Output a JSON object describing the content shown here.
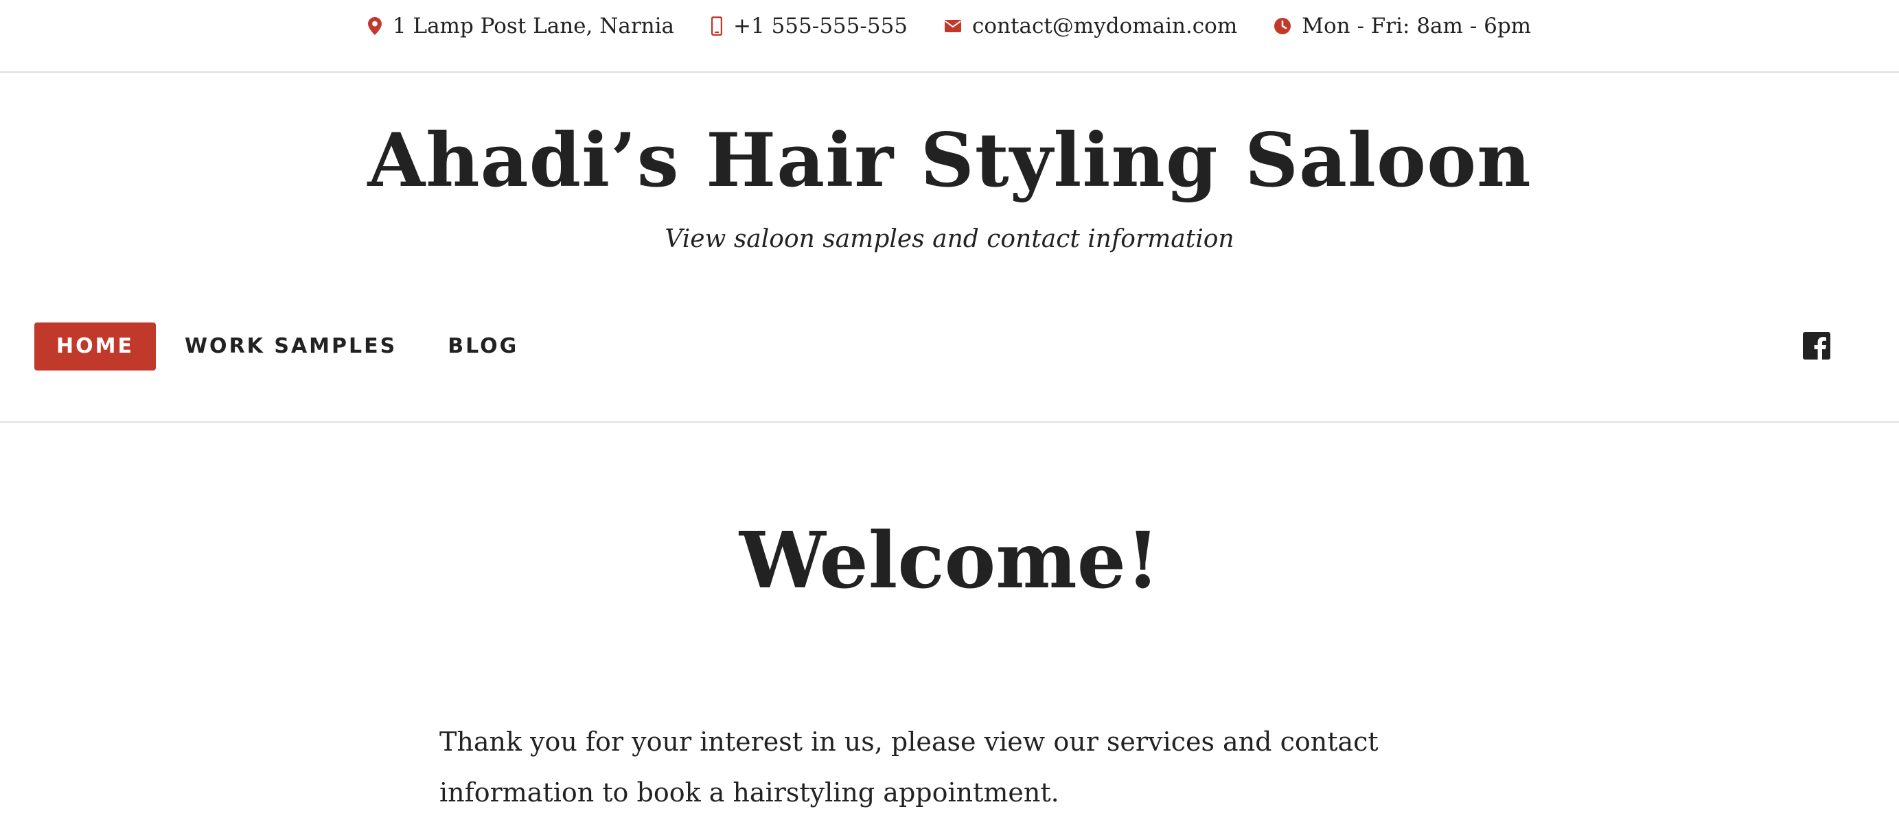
{
  "topbar": {
    "address": "1 Lamp Post Lane, Narnia",
    "phone": "+1 555-555-555",
    "email": "contact@mydomain.com",
    "hours": "Mon - Fri: 8am - 6pm",
    "icons": [
      "map-pin-icon",
      "mobile-phone-icon",
      "envelope-icon",
      "clock-icon"
    ],
    "icon_color": "#c0392b"
  },
  "site": {
    "title": "Ahadi’s Hair Styling Saloon",
    "tagline": "View saloon samples and contact information"
  },
  "nav": {
    "items": [
      {
        "label": "HOME",
        "active": true
      },
      {
        "label": "WORK SAMPLES",
        "active": false
      },
      {
        "label": "BLOG",
        "active": false
      }
    ],
    "active_color": "#c0392b",
    "social_icon": "facebook-icon"
  },
  "content": {
    "heading": "Welcome!",
    "paragraph": "Thank you for your interest in us, please view our services and contact information to book a hairstyling appointment."
  }
}
